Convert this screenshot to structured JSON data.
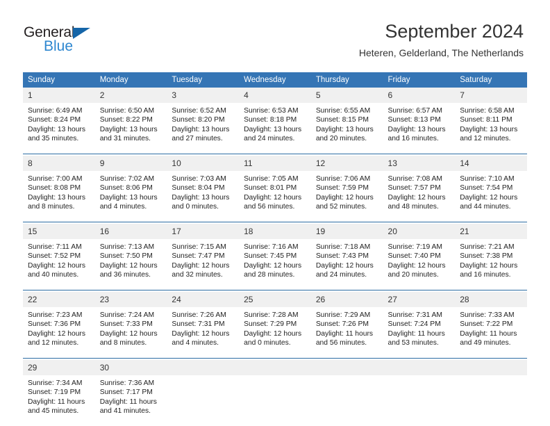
{
  "brand": {
    "name_top": "General",
    "name_bottom": "Blue",
    "triangle_color": "#1565a8",
    "blue_text_color": "#2e87d0"
  },
  "header": {
    "title": "September 2024",
    "subtitle": "Heteren, Gelderland, The Netherlands"
  },
  "theme": {
    "header_bg": "#3575b5",
    "separator": "#2b6ca3",
    "daynum_bg": "#f0f0f0",
    "text": "#333333"
  },
  "weekday_headers": [
    "Sunday",
    "Monday",
    "Tuesday",
    "Wednesday",
    "Thursday",
    "Friday",
    "Saturday"
  ],
  "weeks": [
    {
      "days": [
        {
          "num": "1",
          "sunrise": "Sunrise: 6:49 AM",
          "sunset": "Sunset: 8:24 PM",
          "daylight1": "Daylight: 13 hours",
          "daylight2": "and 35 minutes."
        },
        {
          "num": "2",
          "sunrise": "Sunrise: 6:50 AM",
          "sunset": "Sunset: 8:22 PM",
          "daylight1": "Daylight: 13 hours",
          "daylight2": "and 31 minutes."
        },
        {
          "num": "3",
          "sunrise": "Sunrise: 6:52 AM",
          "sunset": "Sunset: 8:20 PM",
          "daylight1": "Daylight: 13 hours",
          "daylight2": "and 27 minutes."
        },
        {
          "num": "4",
          "sunrise": "Sunrise: 6:53 AM",
          "sunset": "Sunset: 8:18 PM",
          "daylight1": "Daylight: 13 hours",
          "daylight2": "and 24 minutes."
        },
        {
          "num": "5",
          "sunrise": "Sunrise: 6:55 AM",
          "sunset": "Sunset: 8:15 PM",
          "daylight1": "Daylight: 13 hours",
          "daylight2": "and 20 minutes."
        },
        {
          "num": "6",
          "sunrise": "Sunrise: 6:57 AM",
          "sunset": "Sunset: 8:13 PM",
          "daylight1": "Daylight: 13 hours",
          "daylight2": "and 16 minutes."
        },
        {
          "num": "7",
          "sunrise": "Sunrise: 6:58 AM",
          "sunset": "Sunset: 8:11 PM",
          "daylight1": "Daylight: 13 hours",
          "daylight2": "and 12 minutes."
        }
      ]
    },
    {
      "days": [
        {
          "num": "8",
          "sunrise": "Sunrise: 7:00 AM",
          "sunset": "Sunset: 8:08 PM",
          "daylight1": "Daylight: 13 hours",
          "daylight2": "and 8 minutes."
        },
        {
          "num": "9",
          "sunrise": "Sunrise: 7:02 AM",
          "sunset": "Sunset: 8:06 PM",
          "daylight1": "Daylight: 13 hours",
          "daylight2": "and 4 minutes."
        },
        {
          "num": "10",
          "sunrise": "Sunrise: 7:03 AM",
          "sunset": "Sunset: 8:04 PM",
          "daylight1": "Daylight: 13 hours",
          "daylight2": "and 0 minutes."
        },
        {
          "num": "11",
          "sunrise": "Sunrise: 7:05 AM",
          "sunset": "Sunset: 8:01 PM",
          "daylight1": "Daylight: 12 hours",
          "daylight2": "and 56 minutes."
        },
        {
          "num": "12",
          "sunrise": "Sunrise: 7:06 AM",
          "sunset": "Sunset: 7:59 PM",
          "daylight1": "Daylight: 12 hours",
          "daylight2": "and 52 minutes."
        },
        {
          "num": "13",
          "sunrise": "Sunrise: 7:08 AM",
          "sunset": "Sunset: 7:57 PM",
          "daylight1": "Daylight: 12 hours",
          "daylight2": "and 48 minutes."
        },
        {
          "num": "14",
          "sunrise": "Sunrise: 7:10 AM",
          "sunset": "Sunset: 7:54 PM",
          "daylight1": "Daylight: 12 hours",
          "daylight2": "and 44 minutes."
        }
      ]
    },
    {
      "days": [
        {
          "num": "15",
          "sunrise": "Sunrise: 7:11 AM",
          "sunset": "Sunset: 7:52 PM",
          "daylight1": "Daylight: 12 hours",
          "daylight2": "and 40 minutes."
        },
        {
          "num": "16",
          "sunrise": "Sunrise: 7:13 AM",
          "sunset": "Sunset: 7:50 PM",
          "daylight1": "Daylight: 12 hours",
          "daylight2": "and 36 minutes."
        },
        {
          "num": "17",
          "sunrise": "Sunrise: 7:15 AM",
          "sunset": "Sunset: 7:47 PM",
          "daylight1": "Daylight: 12 hours",
          "daylight2": "and 32 minutes."
        },
        {
          "num": "18",
          "sunrise": "Sunrise: 7:16 AM",
          "sunset": "Sunset: 7:45 PM",
          "daylight1": "Daylight: 12 hours",
          "daylight2": "and 28 minutes."
        },
        {
          "num": "19",
          "sunrise": "Sunrise: 7:18 AM",
          "sunset": "Sunset: 7:43 PM",
          "daylight1": "Daylight: 12 hours",
          "daylight2": "and 24 minutes."
        },
        {
          "num": "20",
          "sunrise": "Sunrise: 7:19 AM",
          "sunset": "Sunset: 7:40 PM",
          "daylight1": "Daylight: 12 hours",
          "daylight2": "and 20 minutes."
        },
        {
          "num": "21",
          "sunrise": "Sunrise: 7:21 AM",
          "sunset": "Sunset: 7:38 PM",
          "daylight1": "Daylight: 12 hours",
          "daylight2": "and 16 minutes."
        }
      ]
    },
    {
      "days": [
        {
          "num": "22",
          "sunrise": "Sunrise: 7:23 AM",
          "sunset": "Sunset: 7:36 PM",
          "daylight1": "Daylight: 12 hours",
          "daylight2": "and 12 minutes."
        },
        {
          "num": "23",
          "sunrise": "Sunrise: 7:24 AM",
          "sunset": "Sunset: 7:33 PM",
          "daylight1": "Daylight: 12 hours",
          "daylight2": "and 8 minutes."
        },
        {
          "num": "24",
          "sunrise": "Sunrise: 7:26 AM",
          "sunset": "Sunset: 7:31 PM",
          "daylight1": "Daylight: 12 hours",
          "daylight2": "and 4 minutes."
        },
        {
          "num": "25",
          "sunrise": "Sunrise: 7:28 AM",
          "sunset": "Sunset: 7:29 PM",
          "daylight1": "Daylight: 12 hours",
          "daylight2": "and 0 minutes."
        },
        {
          "num": "26",
          "sunrise": "Sunrise: 7:29 AM",
          "sunset": "Sunset: 7:26 PM",
          "daylight1": "Daylight: 11 hours",
          "daylight2": "and 56 minutes."
        },
        {
          "num": "27",
          "sunrise": "Sunrise: 7:31 AM",
          "sunset": "Sunset: 7:24 PM",
          "daylight1": "Daylight: 11 hours",
          "daylight2": "and 53 minutes."
        },
        {
          "num": "28",
          "sunrise": "Sunrise: 7:33 AM",
          "sunset": "Sunset: 7:22 PM",
          "daylight1": "Daylight: 11 hours",
          "daylight2": "and 49 minutes."
        }
      ]
    },
    {
      "days": [
        {
          "num": "29",
          "sunrise": "Sunrise: 7:34 AM",
          "sunset": "Sunset: 7:19 PM",
          "daylight1": "Daylight: 11 hours",
          "daylight2": "and 45 minutes."
        },
        {
          "num": "30",
          "sunrise": "Sunrise: 7:36 AM",
          "sunset": "Sunset: 7:17 PM",
          "daylight1": "Daylight: 11 hours",
          "daylight2": "and 41 minutes."
        },
        {
          "num": "",
          "sunrise": "",
          "sunset": "",
          "daylight1": "",
          "daylight2": ""
        },
        {
          "num": "",
          "sunrise": "",
          "sunset": "",
          "daylight1": "",
          "daylight2": ""
        },
        {
          "num": "",
          "sunrise": "",
          "sunset": "",
          "daylight1": "",
          "daylight2": ""
        },
        {
          "num": "",
          "sunrise": "",
          "sunset": "",
          "daylight1": "",
          "daylight2": ""
        },
        {
          "num": "",
          "sunrise": "",
          "sunset": "",
          "daylight1": "",
          "daylight2": ""
        }
      ]
    }
  ]
}
